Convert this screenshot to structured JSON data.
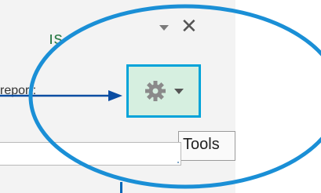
{
  "panel": {
    "title_fragment": "ıs",
    "dropdown_icon": "chevron-down-icon",
    "close_icon": "close-icon",
    "close_glyph": "✕"
  },
  "report": {
    "label": "report:",
    "arrow_icon": "arrow-right-icon"
  },
  "tools_button": {
    "icon": "gear-icon",
    "menu_icon": "chevron-down-icon",
    "tooltip": "Tools"
  },
  "colors": {
    "highlight_ring": "#1a8fd6",
    "button_border": "#00a3d9",
    "button_fill": "#d6efe0",
    "arrow": "#0b4da2",
    "title": "#2f7d4a"
  }
}
